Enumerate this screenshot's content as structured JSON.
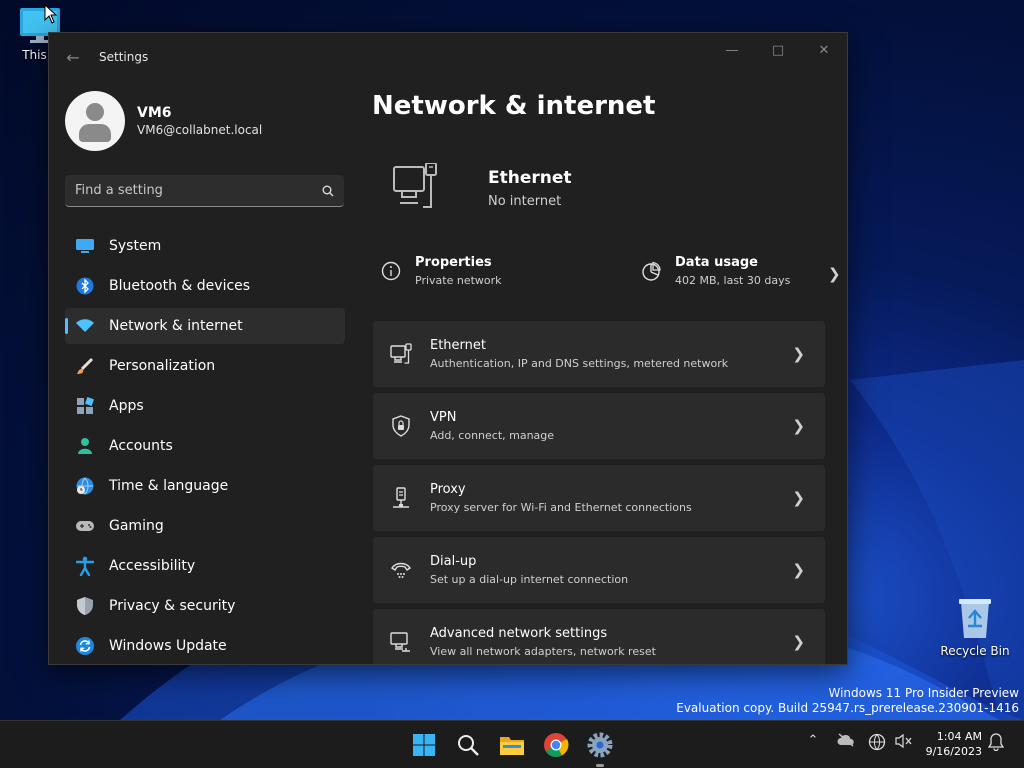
{
  "desktop": {
    "this_pc_label": "This P",
    "recycle_bin_label": "Recycle Bin",
    "watermark_line1": "Windows 11 Pro Insider Preview",
    "watermark_line2": "Evaluation copy. Build 25947.rs_prerelease.230901-1416"
  },
  "window": {
    "title": "Settings",
    "back_icon": "back-arrow-icon",
    "controls": [
      "minimize",
      "maximize",
      "close"
    ]
  },
  "profile": {
    "name": "VM6",
    "email": "VM6@collabnet.local"
  },
  "search": {
    "placeholder": "Find a setting"
  },
  "sidebar": {
    "items": [
      {
        "label": "System",
        "icon": "system-icon",
        "selected": false
      },
      {
        "label": "Bluetooth & devices",
        "icon": "bluetooth-icon",
        "selected": false
      },
      {
        "label": "Network & internet",
        "icon": "network-icon",
        "selected": true
      },
      {
        "label": "Personalization",
        "icon": "brush-icon",
        "selected": false
      },
      {
        "label": "Apps",
        "icon": "apps-icon",
        "selected": false
      },
      {
        "label": "Accounts",
        "icon": "accounts-icon",
        "selected": false
      },
      {
        "label": "Time & language",
        "icon": "globe-clock-icon",
        "selected": false
      },
      {
        "label": "Gaming",
        "icon": "gamepad-icon",
        "selected": false
      },
      {
        "label": "Accessibility",
        "icon": "accessibility-icon",
        "selected": false
      },
      {
        "label": "Privacy & security",
        "icon": "shield-icon",
        "selected": false
      },
      {
        "label": "Windows Update",
        "icon": "update-icon",
        "selected": false
      }
    ]
  },
  "main": {
    "page_title": "Network & internet",
    "hero": {
      "title": "Ethernet",
      "status": "No internet"
    },
    "properties": {
      "title": "Properties",
      "subtitle": "Private network"
    },
    "data_usage": {
      "title": "Data usage",
      "subtitle": "402 MB, last 30 days"
    },
    "cards": [
      {
        "title": "Ethernet",
        "subtitle": "Authentication, IP and DNS settings, metered network",
        "icon": "ethernet-icon"
      },
      {
        "title": "VPN",
        "subtitle": "Add, connect, manage",
        "icon": "vpn-shield-icon"
      },
      {
        "title": "Proxy",
        "subtitle": "Proxy server for Wi-Fi and Ethernet connections",
        "icon": "proxy-icon"
      },
      {
        "title": "Dial-up",
        "subtitle": "Set up a dial-up internet connection",
        "icon": "dialup-icon"
      },
      {
        "title": "Advanced network settings",
        "subtitle": "View all network adapters, network reset",
        "icon": "advanced-network-icon"
      }
    ]
  },
  "taskbar": {
    "apps": [
      "start",
      "search",
      "file-explorer",
      "chrome",
      "settings"
    ],
    "clock_time": "1:04 AM",
    "clock_date": "9/16/2023"
  },
  "colors": {
    "accent": "#4cc2ff",
    "window_bg": "#202020",
    "card_bg": "#2b2b2b"
  }
}
